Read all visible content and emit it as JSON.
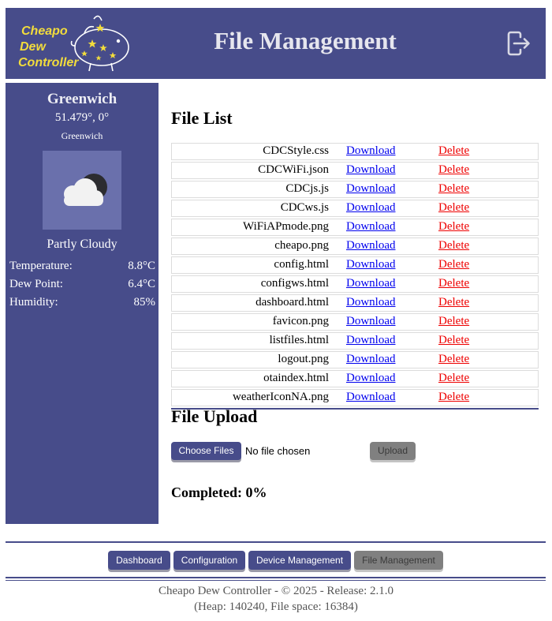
{
  "header": {
    "logo_lines": [
      "Cheapo",
      "Dew",
      "Controller"
    ],
    "title": "File Management",
    "logout_icon": "logout-icon"
  },
  "sidebar": {
    "city": "Greenwich",
    "coords": "51.479°, 0°",
    "city_sub": "Greenwich",
    "weather_icon": "partly-cloudy-night-icon",
    "condition": "Partly Cloudy",
    "rows": [
      {
        "label": "Temperature:",
        "value": "8.8°C"
      },
      {
        "label": "Dew Point:",
        "value": "6.4°C"
      },
      {
        "label": "Humidity:",
        "value": "85%"
      }
    ]
  },
  "file_list": {
    "heading": "File List",
    "download_label": "Download",
    "delete_label": "Delete",
    "files": [
      "CDCStyle.css",
      "CDCWiFi.json",
      "CDCjs.js",
      "CDCws.js",
      "WiFiAPmode.png",
      "cheapo.png",
      "config.html",
      "configws.html",
      "dashboard.html",
      "favicon.png",
      "listfiles.html",
      "logout.png",
      "otaindex.html",
      "weatherIconNA.png"
    ]
  },
  "upload": {
    "heading": "File Upload",
    "choose_label": "Choose Files",
    "no_file_text": "No file chosen",
    "upload_label": "Upload",
    "completed": "Completed: 0%"
  },
  "nav": {
    "dashboard": "Dashboard",
    "configuration": "Configuration",
    "device_management": "Device Management",
    "file_management": "File Management"
  },
  "footer": {
    "line1": "Cheapo Dew Controller - © 2025 - Release: 2.1.0",
    "line2": "(Heap: 140240, File space: 16384)"
  },
  "colors": {
    "accent": "#474c8a",
    "logo_yellow": "#f2dc3c",
    "link_blue": "#0000ee",
    "delete_red": "#ee0000"
  }
}
